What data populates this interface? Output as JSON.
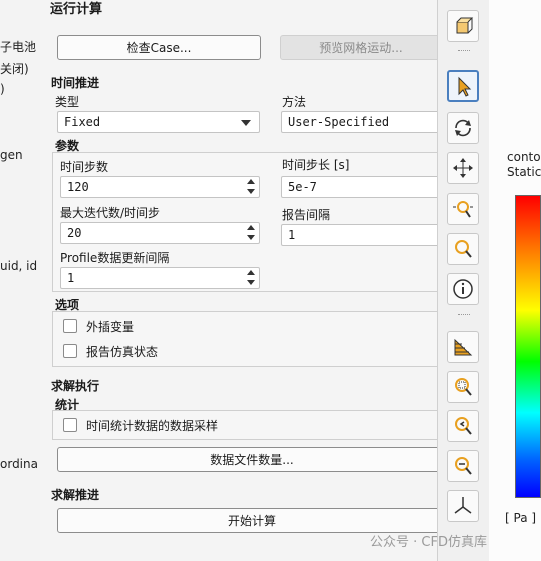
{
  "left_panel": {
    "fragments": [
      "子电池",
      "关闭)",
      ")",
      "gen",
      "uid, id",
      "ordina"
    ]
  },
  "run_calculation": {
    "title": "运行计算",
    "check_case_button": "检查Case...",
    "preview_mesh_button": "预览网格运动...",
    "time_advancement": {
      "section_label": "时间推进",
      "type_label": "类型",
      "type_value": "Fixed",
      "method_label": "方法",
      "method_value": "User-Specified"
    },
    "parameters": {
      "section_label": "参数",
      "time_steps_label": "时间步数",
      "time_steps_value": "120",
      "time_step_size_label": "时间步长 [s]",
      "time_step_size_value": "5e-7",
      "max_iterations_label": "最大迭代数/时间步",
      "max_iterations_value": "20",
      "report_interval_label": "报告间隔",
      "report_interval_value": "1",
      "profile_update_label": "Profile数据更新间隔",
      "profile_update_value": "1"
    },
    "options": {
      "section_label": "选项",
      "extrapolate_label": "外插变量",
      "report_status_label": "报告仿真状态"
    },
    "solution_processing": {
      "section_label": "求解执行",
      "statistics_label": "统计",
      "sampling_label": "时间统计数据的数据采样",
      "data_file_button": "数据文件数量..."
    },
    "solution_advancement": {
      "section_label": "求解推进",
      "start_button": "开始计算"
    }
  },
  "viewport": {
    "contour_line1": "conto",
    "contour_line2": "Static",
    "unit_label": "[ Pa ]"
  },
  "watermark": "公众号 · CFD仿真库",
  "colors": {
    "accent": "#4a7fbf",
    "pointer": "#e8a020"
  }
}
